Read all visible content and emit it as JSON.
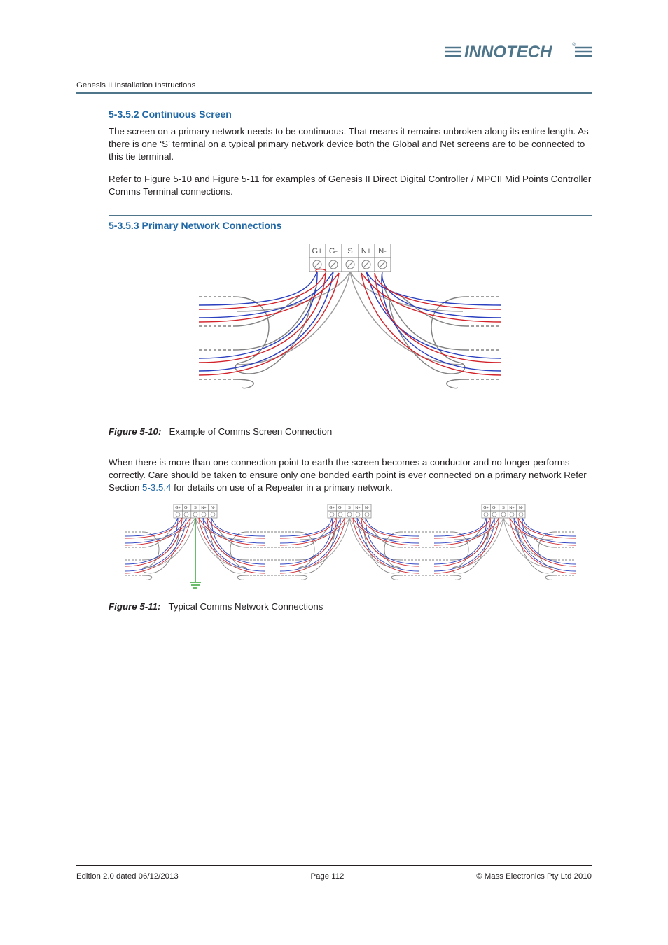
{
  "logo_text": "INNOTECH",
  "running_head": "Genesis II Installation Instructions",
  "sections": {
    "s1": {
      "heading": "5-3.5.2 Continuous Screen",
      "p1": "The screen on a primary network needs to be continuous.  That means it remains unbroken along its entire length.  As there is one ‘S’ terminal on a typical primary network device both the Global and Net screens are to be connected to this tie terminal.",
      "p2": "Refer to Figure 5-10 and Figure 5-11 for examples of Genesis II Direct Digital Controller / MPCII Mid Points Controller Comms Terminal connections."
    },
    "s2": {
      "heading": "5-3.5.3 Primary Network Connections"
    }
  },
  "figures": {
    "f10": {
      "label": "Figure 5-10:",
      "caption": "Example of Comms Screen Connection"
    },
    "f11": {
      "label": "Figure 5-11:",
      "caption": "Typical Comms Network Connections"
    }
  },
  "terminals": [
    "G+",
    "G-",
    "S",
    "N+",
    "N-"
  ],
  "para_after_fig10_a": "When there is more than one connection point to earth the screen becomes a conductor and no longer performs correctly.  Care should be taken to ensure only one bonded earth point is ever connected on a primary network Refer Section ",
  "para_after_fig10_link": "5-3.5.4",
  "para_after_fig10_b": " for details on use of a Repeater in a primary network.",
  "footer": {
    "left": "Edition 2.0 dated 06/12/2013",
    "center": "Page 112",
    "right": "©  Mass Electronics Pty Ltd  2010"
  }
}
